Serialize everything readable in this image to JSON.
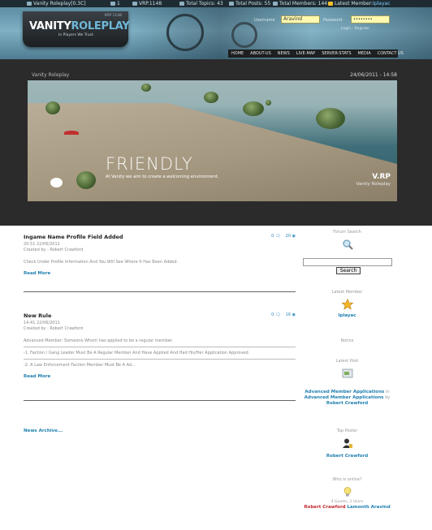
{
  "topbar": {
    "user": "Vanity Roleplay[0.3C]",
    "online_count": "1",
    "version": "VRP.1148",
    "total_topics": "Total Topics: 43",
    "total_posts": "Total Posts: 55",
    "total_members": "Total Members: 144",
    "latest_member_label": "Latest Member:",
    "latest_member": "Iplayac"
  },
  "header": {
    "logo_version": "VRP 1148",
    "logo_vanity": "VANITY",
    "logo_roleplay": "ROLEPLAY",
    "logo_tagline": "In Players We Trust.",
    "username_label": "Username",
    "username_value": "Aravind",
    "password_label": "Password",
    "password_value": "••••••••",
    "login_link": "Login - Register"
  },
  "nav": [
    "HOME",
    "ABOUT-US",
    "NEWS",
    "LIVE-MAP",
    "SERVER-STATS",
    "MEDIA",
    "CONTACT US"
  ],
  "band": {
    "title": "Vanity Roleplay",
    "date": "24/06/2011 - 14:58"
  },
  "slide": {
    "headline": "FRIENDLY",
    "subline": "At Vanity we aim to create a welcoming environment.",
    "brand": "V.RP",
    "brand_sub": "Vanity Roleplay"
  },
  "posts": [
    {
      "title": "Ingame Name Profile Field Added",
      "time": "20:51 22/06/2011",
      "author": "Created by : Robert Crawford",
      "body": [
        "Check Under Profile Information And You Will See Where It Has Been Added."
      ],
      "read_more": "Read More",
      "comments": "0",
      "views": "20"
    },
    {
      "title": "New Rule",
      "time": "14:41 22/06/2011",
      "author": "Created by : Robert Crawford",
      "body": [
        "Advanced Member: Someone Whom has applied to be a regular member.",
        "-1. Faction / Gang Leader Must Be A Regular Member And Have Applied And Had His/Her Application Approved.",
        "-2. A Law Enforcement Faction Member Must Be A Ad..."
      ],
      "read_more": "Read More",
      "comments": "0",
      "views": "16"
    }
  ],
  "archive": "News Archive...",
  "sidebar": {
    "search_title": "Forum Search",
    "search_button": "Search",
    "latest_member_title": "Latest Member",
    "latest_member": "Iplayac",
    "notice_title": "Notice",
    "latest_post_title": "Latest Post",
    "latest_post_topic": "Advanced Member Applications",
    "latest_post_in": "in",
    "latest_post_forum": "Advanced Member Applications",
    "latest_post_by": "by",
    "latest_post_author": "Robert Crawford",
    "top_poster_title": "Top Poster",
    "top_poster": "Robert Crawford",
    "online_title": "Who is online?",
    "online_summary": "4 Guests, 3 Users",
    "online_users": [
      "Robert Crawford",
      "Lamonth",
      "Aravind"
    ]
  },
  "colors": {
    "link": "#1f7fb0",
    "online_admin": "#c0282d"
  }
}
